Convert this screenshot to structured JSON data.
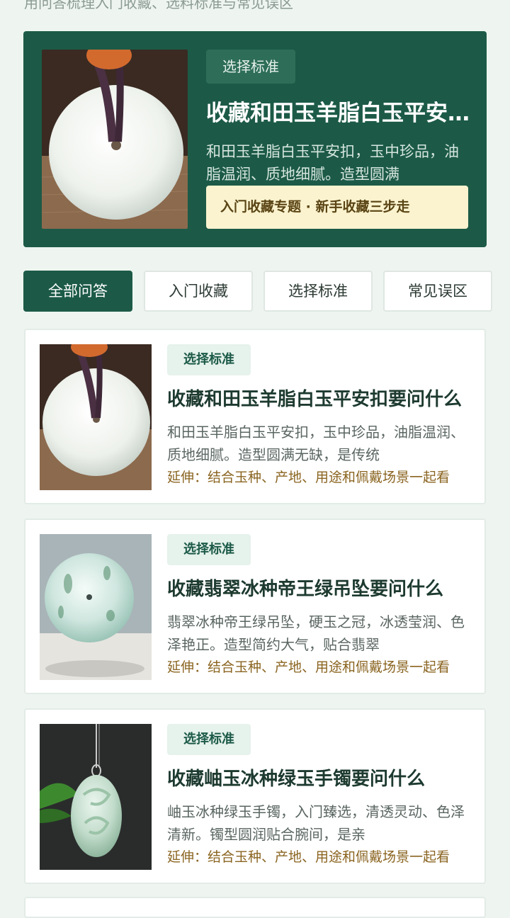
{
  "header": {
    "subtitle": "用问答梳理入门收藏、选料标准与常见误区"
  },
  "hero": {
    "tag": "选择标准",
    "title": "收藏和田玉羊脂白玉平安扣要问什么",
    "description": "和田玉羊脂白玉平安扣，玉中珍品，油脂温润、质地细腻。造型圆满",
    "banner": "入门收藏专题 · 新手收藏三步走"
  },
  "tabs": [
    {
      "label": "全部问答",
      "active": true
    },
    {
      "label": "入门收藏",
      "active": false
    },
    {
      "label": "选择标准",
      "active": false
    },
    {
      "label": "常见误区",
      "active": false
    }
  ],
  "cards": [
    {
      "tag": "选择标准",
      "title": "收藏和田玉羊脂白玉平安扣要问什么",
      "description": "和田玉羊脂白玉平安扣，玉中珍品，油脂温润、质地细腻。造型圆满无缺，是传统",
      "extension": "延伸：结合玉种、产地、用途和佩戴场景一起看"
    },
    {
      "tag": "选择标准",
      "title": "收藏翡翠冰种帝王绿吊坠要问什么",
      "description": "翡翠冰种帝王绿吊坠，硬玉之冠，冰透莹润、色泽艳正。造型简约大气，贴合翡翠",
      "extension": "延伸：结合玉种、产地、用途和佩戴场景一起看"
    },
    {
      "tag": "选择标准",
      "title": "收藏岫玉冰种绿玉手镯要问什么",
      "description": "岫玉冰种绿玉手镯，入门臻选，清透灵动、色泽清新。镯型圆润贴合腕间，是亲",
      "extension": "延伸：结合玉种、产地、用途和佩戴场景一起看"
    }
  ],
  "colors": {
    "primary": "#1c5a47",
    "background": "#eef5f0",
    "banner": "#fbf3cf",
    "extension_text": "#8a6420"
  }
}
